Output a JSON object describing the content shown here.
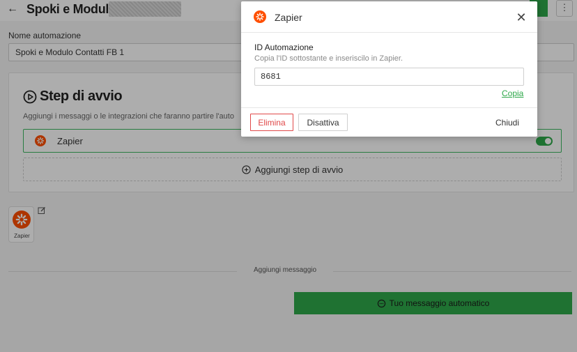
{
  "header": {
    "back_icon": "arrow-left-icon",
    "title": "Spoki e Modulo",
    "more_icon": "more-vertical-icon"
  },
  "automation_name": {
    "label": "Nome automazione",
    "value": "Spoki e Modulo Contatti FB 1"
  },
  "start_step": {
    "icon": "play-circle-icon",
    "title": "Step di avvio",
    "description": "Aggiungi i messaggi o le integrazioni che faranno partire l'auto",
    "integration": {
      "icon": "zapier-icon",
      "label": "Zapier",
      "enabled": true
    },
    "add_button": {
      "icon": "plus-circle-icon",
      "label": "Aggiungi step di avvio"
    }
  },
  "flow": {
    "tile_label": "Zapier",
    "tile_icon": "zapier-icon",
    "edit_icon": "edit-icon",
    "add_message_label": "Aggiungi messaggio",
    "auto_message_button": "Tuo messaggio automatico",
    "auto_message_icon": "chat-icon"
  },
  "modal": {
    "logo_icon": "zapier-icon",
    "title": "Zapier",
    "close_icon": "close-icon",
    "field_label": "ID Automazione",
    "field_help": "Copia l'ID sottostante e inseriscilo in Zapier.",
    "id_value": "8681",
    "copy_label": "Copia",
    "delete_label": "Elimina",
    "disable_label": "Disattiva",
    "close_label": "Chiudi"
  },
  "colors": {
    "accent_green": "#2ea84a",
    "danger_red": "#e04848",
    "zapier_orange": "#ff4f00"
  }
}
